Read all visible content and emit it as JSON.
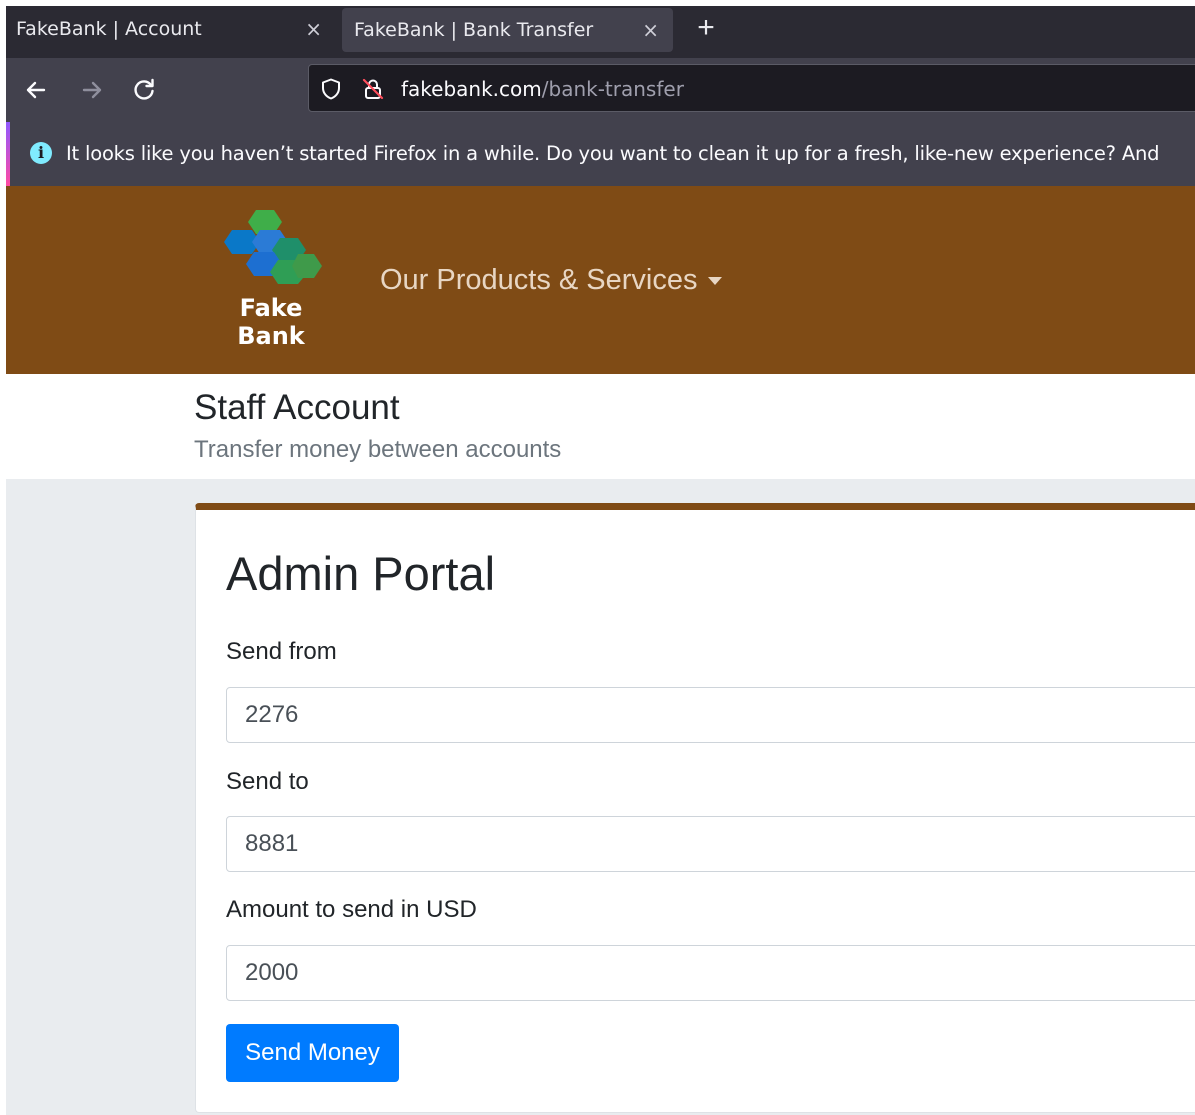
{
  "browser": {
    "tabs": [
      {
        "title": "FakeBank | Account",
        "close": "×"
      },
      {
        "title": "FakeBank | Bank Transfer",
        "close": "×"
      }
    ],
    "new_tab": "+",
    "url": {
      "host": "fakebank.com",
      "path": "/bank-transfer"
    },
    "notification": "It looks like you haven’t started Firefox in a while. Do you want to clean it up for a fresh, like-new experience? And"
  },
  "site": {
    "logo": {
      "line1": "Fake",
      "line2": "Bank",
      "colors": [
        "#2b7bd6",
        "#3fae49",
        "#1f8f6a",
        "#0a78c8"
      ]
    },
    "nav_label": "Our Products & Services",
    "header_color": "#7f4b15"
  },
  "page": {
    "title": "Staff Account",
    "subtitle": "Transfer money between accounts"
  },
  "form": {
    "title": "Admin Portal",
    "from_label": "Send from",
    "from_value": "2276",
    "to_label": "Send to",
    "to_value": "8881",
    "amount_label": "Amount to send in USD",
    "amount_value": "2000",
    "submit_label": "Send Money",
    "submit_color": "#007bff"
  }
}
